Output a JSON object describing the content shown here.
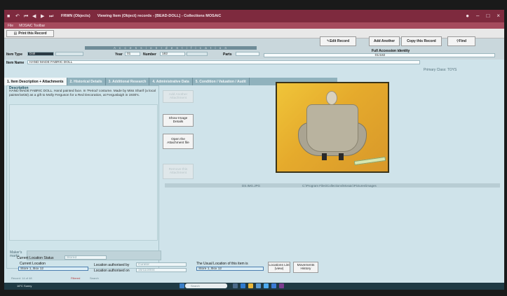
{
  "window": {
    "title": "Viewing Item (Object) records - [BEAD-DOLL] - Collections MOSAiC",
    "app_tab": "FRWN (Objects)"
  },
  "menu": {
    "items": [
      "File",
      "MOSAiC Toolbar"
    ]
  },
  "toolbar": {
    "print_label": "Print this Record"
  },
  "accession": {
    "strip_label": "A c c e s s i o n   I d e n t i f i c a t i o n",
    "item_type_label": "Item Type",
    "item_type_value": "Doll",
    "year_label": "Year",
    "year_value": "01",
    "number_label": "Number",
    "number_value": "182",
    "parts_label": "Parts",
    "item_name_label": "Item Name",
    "item_name_value": "HAND MADE FABRIC DOLL",
    "full_identity_label": "Full Accession identity",
    "full_identity_value": "01/182",
    "primary_class": "Primary Class: TOYS"
  },
  "actions": {
    "edit": "Edit Record",
    "add_another": "Add Another",
    "copy": "Copy this Record",
    "find": "Find"
  },
  "tabs": [
    "1. Item Description + Attachments",
    "2. Historical Details",
    "3. Additional Research",
    "4. Administrative Data",
    "5. Condition / Valuation / Audit"
  ],
  "description": {
    "label": "Description",
    "text": "HAND MADE FABRIC DOLL. Hand painted face. In 'Period' costume. Made by Miss Sharif (a local painter/artist) as a gift to Molly Ferguson for a Red Decoration, at Ferguslaigh in 1930's.",
    "makers_label": "Maker's marks"
  },
  "attachments": {
    "add": "Add Another Attachment",
    "show": "Show Image Details",
    "open": "Open the Attachment file",
    "remove": "Remove this Attachment"
  },
  "image_caption": {
    "left": "DS.IMG.JPG",
    "right": "C:\\Program Files\\Collections\\Mosaic\\Pictures\\images"
  },
  "location": {
    "status_label": "Current Location Status",
    "status_value": "Stored",
    "current_label": "Current Location",
    "current_value": "Store 1, Box 12",
    "authorised_by_label": "Location authorised by",
    "authorised_by_value": "Curator",
    "authorised_on_label": "Location authorised on",
    "authorised_on_value": "16/11/2004",
    "usual_label": "The Usual Location of this item is",
    "usual_value": "Store 1, Box 12",
    "list_button": "Locations List (view)",
    "movements_button": "Movements History"
  },
  "status_bar": {
    "record_nav": "Record: 14 of 48",
    "filtered": "Filtered",
    "search": "Search"
  },
  "taskbar": {
    "search_placeholder": "Search",
    "weather": "16°C Sunny"
  },
  "colors": {
    "title_red": "#7e2a3e",
    "panel_blue": "#cfe3ea",
    "tab_blue": "#90b2bd"
  }
}
